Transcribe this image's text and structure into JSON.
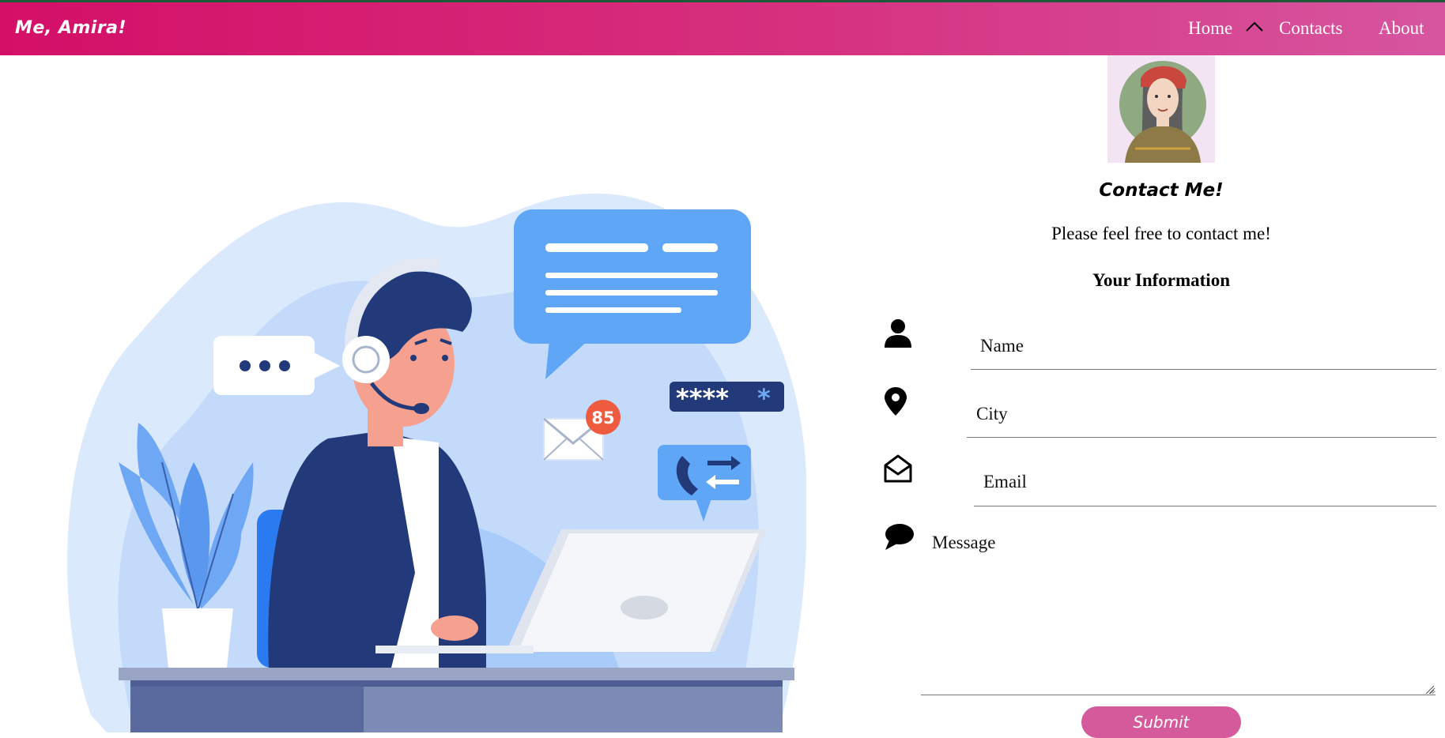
{
  "brand": "Me, Amira!",
  "nav": {
    "home": "Home",
    "contacts": "Contacts",
    "about": "About",
    "caret_icon": "chevron-up-icon"
  },
  "hero": {
    "illustration": "customer-support-illustration",
    "notification_count": "85"
  },
  "contact": {
    "title": "Contact Me!",
    "subtitle": "Please feel free to contact me!",
    "section_title": "Your Information"
  },
  "form": {
    "name_placeholder": "Name",
    "city_placeholder": "City",
    "email_placeholder": "Email",
    "message_placeholder": "Message",
    "submit_label": "Submit",
    "icons": [
      "user-icon",
      "location-pin-icon",
      "envelope-open-icon",
      "chat-bubble-icon"
    ]
  },
  "colors": {
    "nav_start": "#d40f68",
    "nav_end": "#d7559f",
    "submit": "#d45a9c",
    "illustration_blue": "#5fa6f7",
    "navy": "#22397a"
  }
}
